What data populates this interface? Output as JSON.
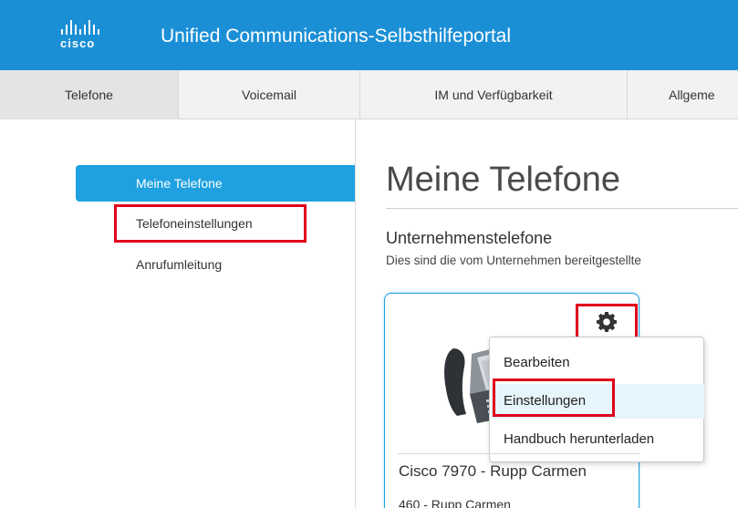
{
  "header": {
    "logo_text": "cisco",
    "title": "Unified Communications-Selbsthilfeportal"
  },
  "tabs": [
    {
      "label": "Telefone"
    },
    {
      "label": "Voicemail"
    },
    {
      "label": "IM und Verfügbarkeit"
    },
    {
      "label": "Allgeme"
    }
  ],
  "sidebar": {
    "items": [
      {
        "label": "Meine Telefone"
      },
      {
        "label": "Telefoneinstellungen"
      },
      {
        "label": "Anrufumleitung"
      }
    ]
  },
  "main": {
    "title": "Meine Telefone",
    "section_title": "Unternehmenstelefone",
    "section_desc": "Dies sind die vom Unternehmen bereitgestellte"
  },
  "phone_card": {
    "name": "Cisco 7970 - Rupp Carmen",
    "line": "460 - Rupp Carmen",
    "icon": "gear-icon"
  },
  "context_menu": {
    "items": [
      {
        "label": "Bearbeiten"
      },
      {
        "label": "Einstellungen"
      },
      {
        "label": "Handbuch herunterladen"
      }
    ]
  },
  "colors": {
    "header_bg": "#1b8fd6",
    "sidebar_active": "#1fa0e0",
    "highlight_box": "#e0001b"
  }
}
